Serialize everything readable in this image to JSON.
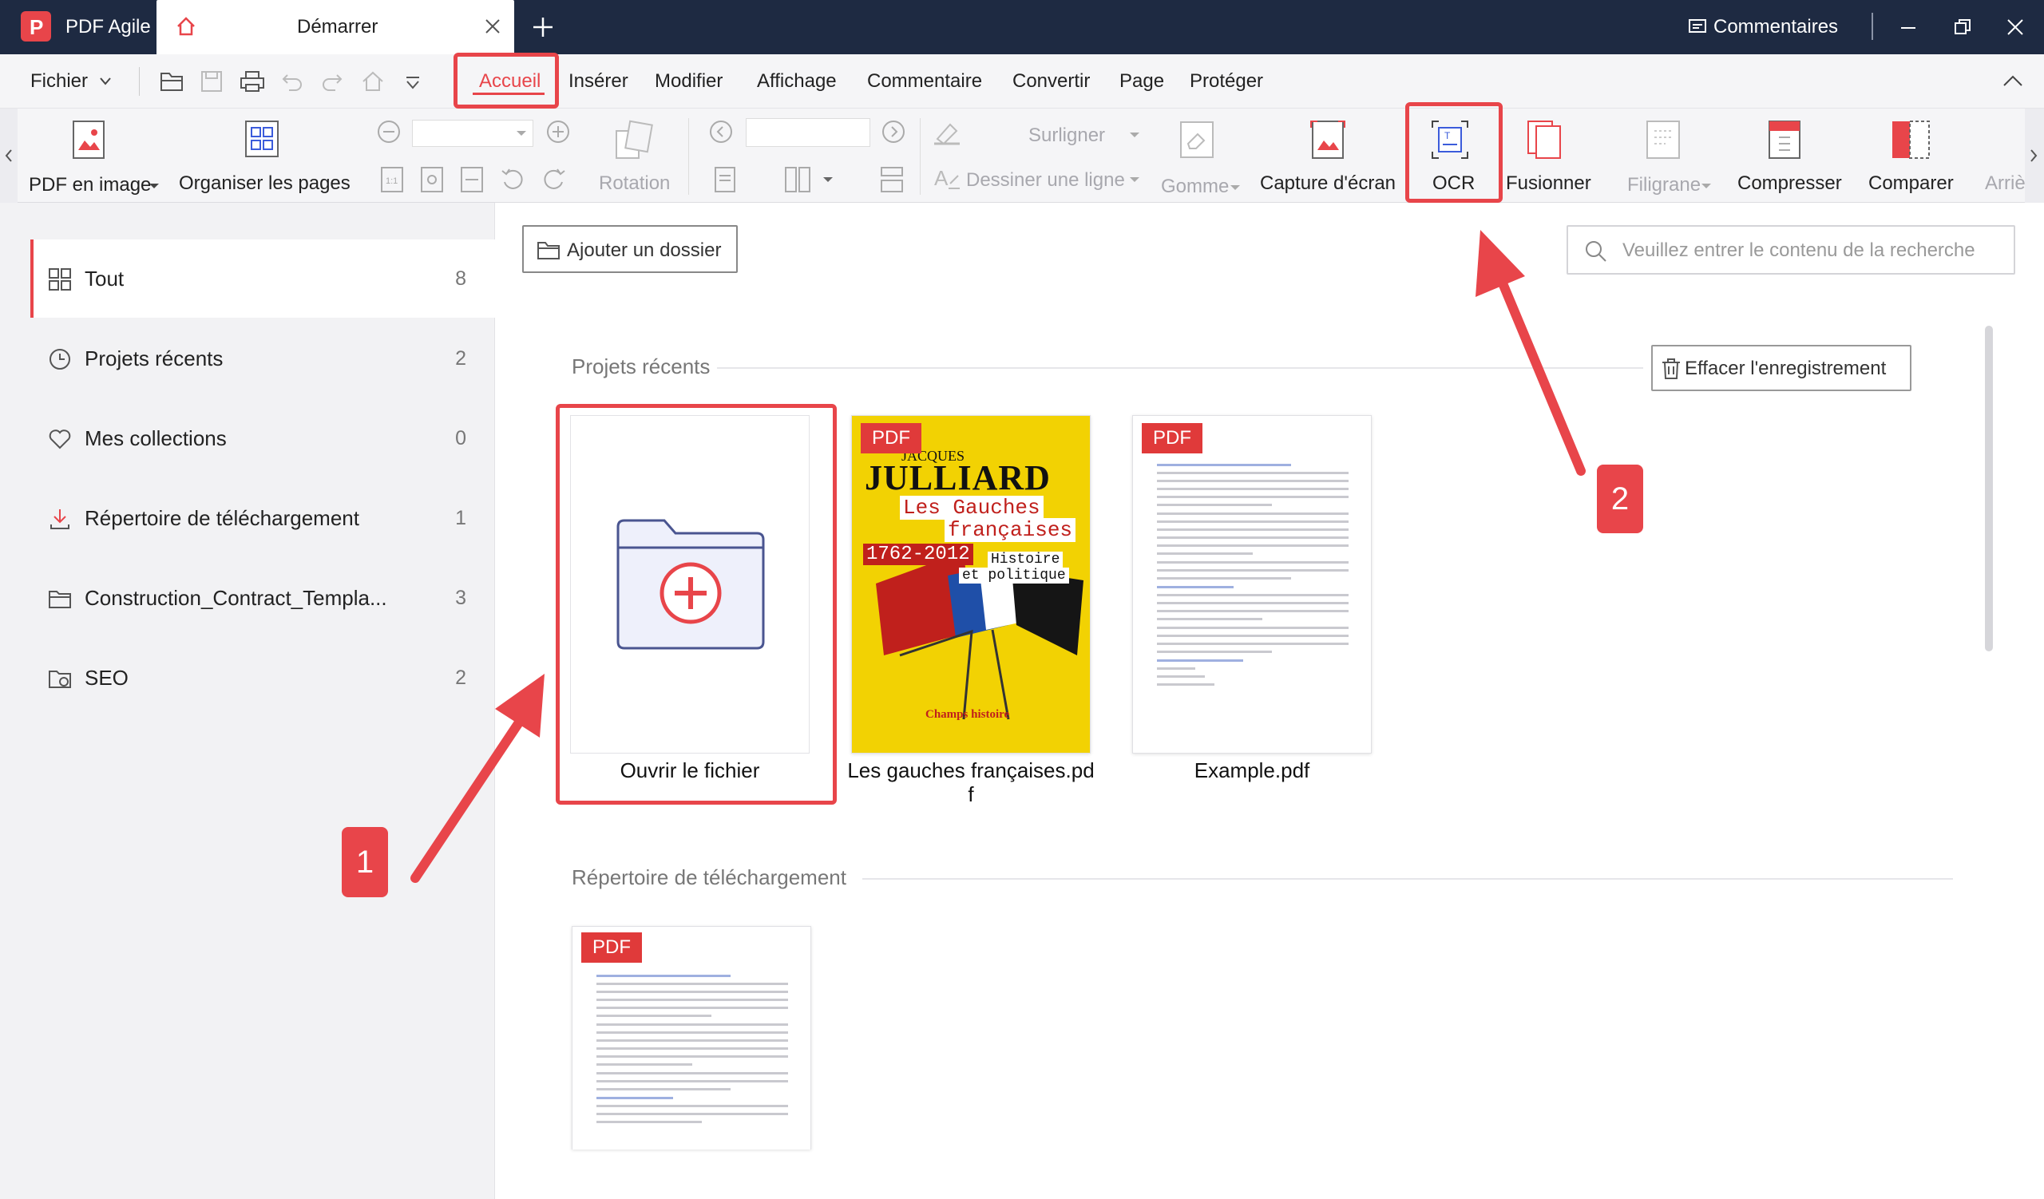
{
  "app": {
    "name": "PDF Agile",
    "tab_title": "Démarrer",
    "comments_label": "Commentaires"
  },
  "menu": {
    "file_label": "Fichier",
    "tabs": [
      "Accueil",
      "Insérer",
      "Modifier",
      "Affichage",
      "Commentaire",
      "Convertir",
      "Page",
      "Protéger"
    ]
  },
  "ribbon": {
    "pdf_to_image": "PDF en image",
    "organize_pages": "Organiser les pages",
    "rotation": "Rotation",
    "highlight": "Surligner",
    "draw_line": "Dessiner une ligne",
    "eraser": "Gomme",
    "screenshot": "Capture d'écran",
    "ocr": "OCR",
    "merge": "Fusionner",
    "watermark": "Filigrane",
    "compress": "Compresser",
    "compare": "Comparer",
    "background": "Arriè"
  },
  "sidebar": {
    "items": [
      {
        "label": "Tout",
        "count": "8",
        "icon": "grid-icon"
      },
      {
        "label": "Projets récents",
        "count": "2",
        "icon": "clock-icon"
      },
      {
        "label": "Mes collections",
        "count": "0",
        "icon": "heart-icon"
      },
      {
        "label": "Répertoire de téléchargement",
        "count": "1",
        "icon": "download-icon"
      },
      {
        "label": "Construction_Contract_Templa...",
        "count": "3",
        "icon": "folder-icon"
      },
      {
        "label": "SEO",
        "count": "2",
        "icon": "folder-icon"
      }
    ]
  },
  "main": {
    "add_folder_label": "Ajouter un dossier",
    "search_placeholder": "Veuillez entrer le contenu de la recherche",
    "recent_title": "Projets récents",
    "clear_label": "Effacer l'enregistrement",
    "open_file_label": "Ouvrir le fichier",
    "files": [
      {
        "name": "Les gauches françaises.pd\nf",
        "badge": "PDF"
      },
      {
        "name": "Example.pdf",
        "badge": "PDF"
      }
    ],
    "download_title": "Répertoire de téléchargement",
    "download_badge": "PDF",
    "book_cover": {
      "author_first": "JACQUES",
      "author_last": "JULLIARD",
      "title1": "Les Gauches",
      "title2": "françaises",
      "years": "1762-2012",
      "subtitle1": "Histoire",
      "subtitle2": "et politique",
      "publisher": "Champs histoire"
    }
  },
  "annotations": {
    "step1": "1",
    "step2": "2"
  },
  "colors": {
    "titlebar": "#1e2a42",
    "accent": "#e8454a",
    "pdf_badge": "#e03a3a"
  }
}
